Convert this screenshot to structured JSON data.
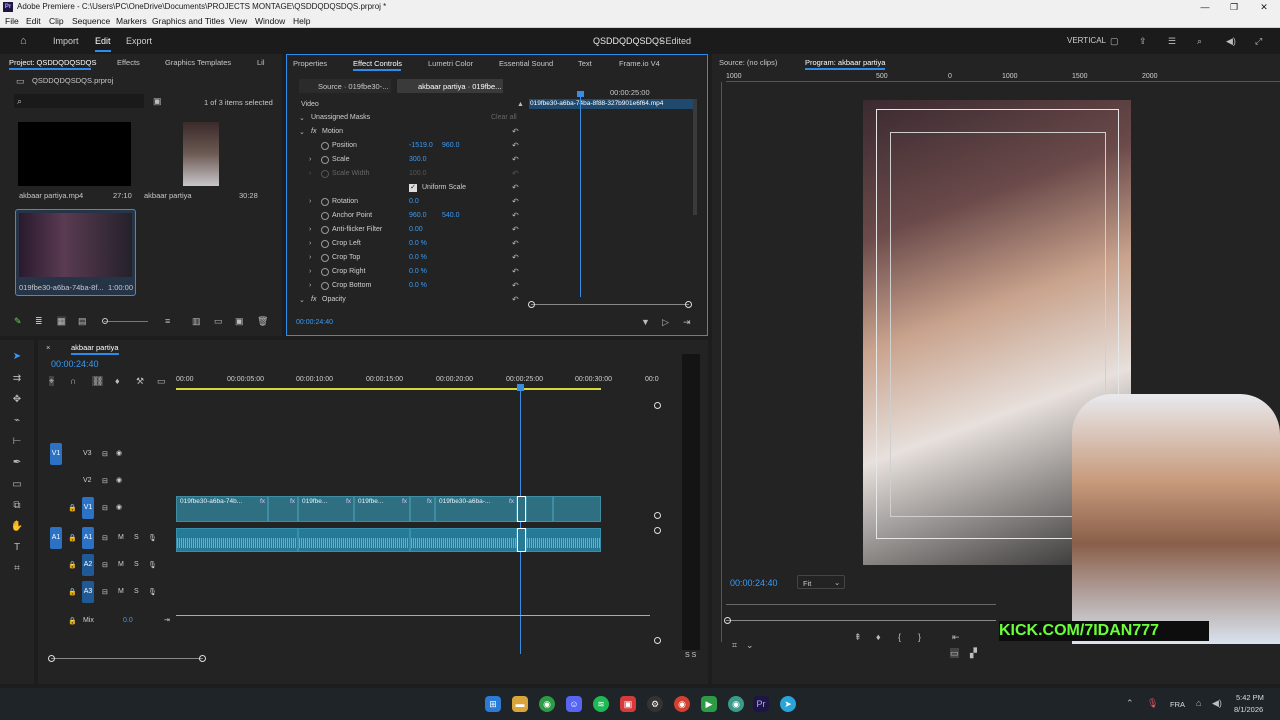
{
  "window": {
    "title": "Adobe Premiere - C:\\Users\\PC\\OneDrive\\Documents\\PROJECTS MONTAGE\\QSDDQDQSDQS.prproj *",
    "minimize": "—",
    "maximize": "❐",
    "close": "✕"
  },
  "menu": [
    "File",
    "Edit",
    "Clip",
    "Sequence",
    "Markers",
    "Graphics and Titles",
    "View",
    "Window",
    "Help"
  ],
  "workspace": {
    "import": "Import",
    "edit": "Edit",
    "export": "Export",
    "project_name": "QSDDQDQSDQS",
    "status": "- Edited",
    "vertical_label": "VERTICAL"
  },
  "project_panel": {
    "tabs": [
      "Project: QSDDQDQSDQS",
      "Effects",
      "Graphics Templates",
      "Lil"
    ],
    "file": "QSDDQDQSDQS.prproj",
    "selection": "1 of 3 items selected",
    "items": [
      {
        "name": "akbaar partiya.mp4",
        "duration": "27:10"
      },
      {
        "name": "akbaar partiya",
        "duration": "30:28"
      },
      {
        "name": "019fbe30-a6ba-74ba-8f...",
        "duration": "1:00:00"
      }
    ]
  },
  "effect_controls": {
    "tabs": [
      "Properties",
      "Effect Controls",
      "Lumetri Color",
      "Essential Sound",
      "Text",
      "Frame.io V4"
    ],
    "source_tab": "Source · 019fbe30-...",
    "seq_tab": "akbaar partiya · 019fbe...",
    "ruler_time": "00:00:25:00",
    "clip_name": "019fbe30-a6ba-74ba-8f88-327b901e6f64.mp4",
    "video_label": "Video",
    "masks": "Unassigned Masks",
    "clear_all": "Clear all",
    "motion": "Motion",
    "position": {
      "label": "Position",
      "x": "-1519.0",
      "y": "960.0"
    },
    "scale": {
      "label": "Scale",
      "value": "300.0"
    },
    "scale_width": {
      "label": "Scale Width",
      "value": "100.0"
    },
    "uniform_scale": "Uniform Scale",
    "rotation": {
      "label": "Rotation",
      "value": "0.0"
    },
    "anchor": {
      "label": "Anchor Point",
      "x": "960.0",
      "y": "540.0"
    },
    "antiflicker": {
      "label": "Anti-flicker Filter",
      "value": "0.00"
    },
    "crop_left": {
      "label": "Crop Left",
      "value": "0.0 %"
    },
    "crop_top": {
      "label": "Crop Top",
      "value": "0.0 %"
    },
    "crop_right": {
      "label": "Crop Right",
      "value": "0.0 %"
    },
    "crop_bottom": {
      "label": "Crop Bottom",
      "value": "0.0 %"
    },
    "opacity": "Opacity",
    "timecode": "00:00:24:40"
  },
  "monitors": {
    "source_tab": "Source: (no clips)",
    "program_tab": "Program: akbaar partiya",
    "timecode": "00:00:24:40",
    "fit": "Fit",
    "ruler_marks": [
      "1000",
      "500",
      "0",
      "500",
      "1000",
      "1500",
      "2000"
    ],
    "watermark": "KICK.COM/7IDAN777"
  },
  "timeline": {
    "sequence_tab": "akbaar partiya",
    "timecode": "00:00:24:40",
    "ruler": [
      "00:00",
      "00:00:05:00",
      "00:00:10:00",
      "00:00:15:00",
      "00:00:20:00",
      "00:00:25:00",
      "00:00:30:00",
      "00:0"
    ],
    "tracks": {
      "v3": "V3",
      "v2": "V2",
      "v1": "V1",
      "a1": "A1",
      "a2": "A2",
      "a3": "A3",
      "mix": "Mix",
      "mix_val": "0.0"
    },
    "clips": [
      "019fbe30-a6ba-74b...",
      "019fbe...",
      "019fbe...",
      "019fbe30-a6ba-..."
    ],
    "meter_label": "S S"
  },
  "taskbar": {
    "lang": "FRA",
    "time": "5:42 PM",
    "date": "8/1/2026"
  }
}
